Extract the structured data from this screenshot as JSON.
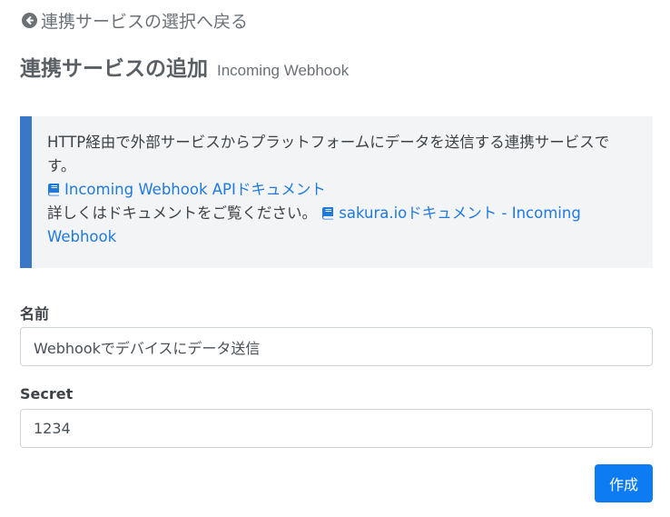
{
  "back_link": {
    "label": "連携サービスの選択へ戻る",
    "icon": "arrow-circle-left-icon"
  },
  "header": {
    "title": "連携サービスの追加",
    "subtitle": "Incoming Webhook"
  },
  "info_box": {
    "description": "HTTP経由で外部サービスからプラットフォームにデータを送信する連携サービスです。",
    "api_doc_link": "Incoming Webhook APIドキュメント",
    "detail_text": "詳しくはドキュメントをご覧ください。",
    "sakura_doc_link": "sakura.ioドキュメント - Incoming Webhook",
    "link_icon": "book-icon",
    "accent_color": "#3a77c7"
  },
  "form": {
    "name": {
      "label": "名前",
      "value": "Webhookでデバイスにデータ送信"
    },
    "secret": {
      "label": "Secret",
      "value": "1234"
    },
    "submit_label": "作成"
  },
  "colors": {
    "primary": "#0d7cf2",
    "link": "#1f7ae0",
    "muted_text": "#6b7177"
  }
}
